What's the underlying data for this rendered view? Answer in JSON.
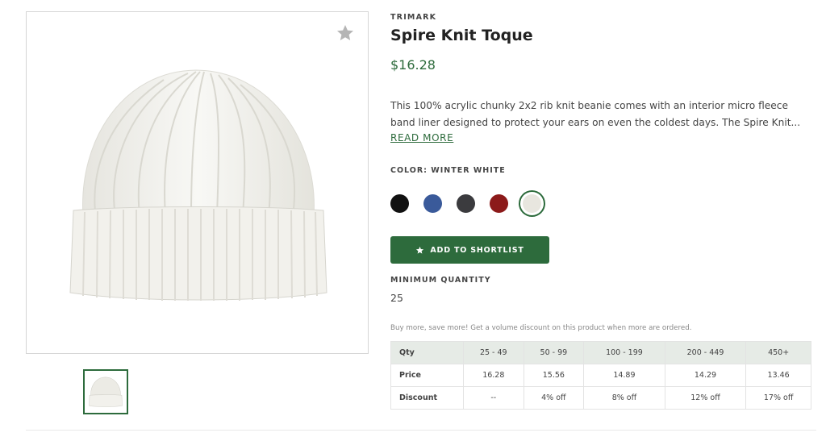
{
  "product": {
    "brand": "TRIMARK",
    "title": "Spire Knit Toque",
    "price": "$16.28",
    "description": "This 100% acrylic chunky 2x2 rib knit beanie comes with an interior micro fleece band liner designed to protect your ears on even the coldest days. The Spire Knit...",
    "read_more": "READ MORE",
    "color_label": "COLOR: WINTER WHITE",
    "colors": [
      {
        "name": "black",
        "hex": "#111111",
        "selected": false
      },
      {
        "name": "blue",
        "hex": "#3a5a9a",
        "selected": false
      },
      {
        "name": "charcoal",
        "hex": "#3b3b3e",
        "selected": false
      },
      {
        "name": "red",
        "hex": "#8c1a1a",
        "selected": false
      },
      {
        "name": "winter-white",
        "hex": "#e8e6df",
        "selected": true
      }
    ],
    "shortlist_button": "ADD TO SHORTLIST",
    "min_qty_label": "MINIMUM QUANTITY",
    "min_qty_value": "25",
    "volume_note": "Buy more, save more! Get a volume discount on this product when more are ordered."
  },
  "pricing_table": {
    "headers": [
      "Qty",
      "25 - 49",
      "50 - 99",
      "100 - 199",
      "200 - 449",
      "450+"
    ],
    "rows": [
      [
        "Price",
        "16.28",
        "15.56",
        "14.89",
        "14.29",
        "13.46"
      ],
      [
        "Discount",
        "--",
        "4% off",
        "8% off",
        "12% off",
        "17% off"
      ]
    ]
  },
  "colors": {
    "accent": "#2d6b3c",
    "table_header": "#e6ebe6"
  },
  "icons": {
    "favorite": "star-icon",
    "shortlist": "star-icon"
  }
}
